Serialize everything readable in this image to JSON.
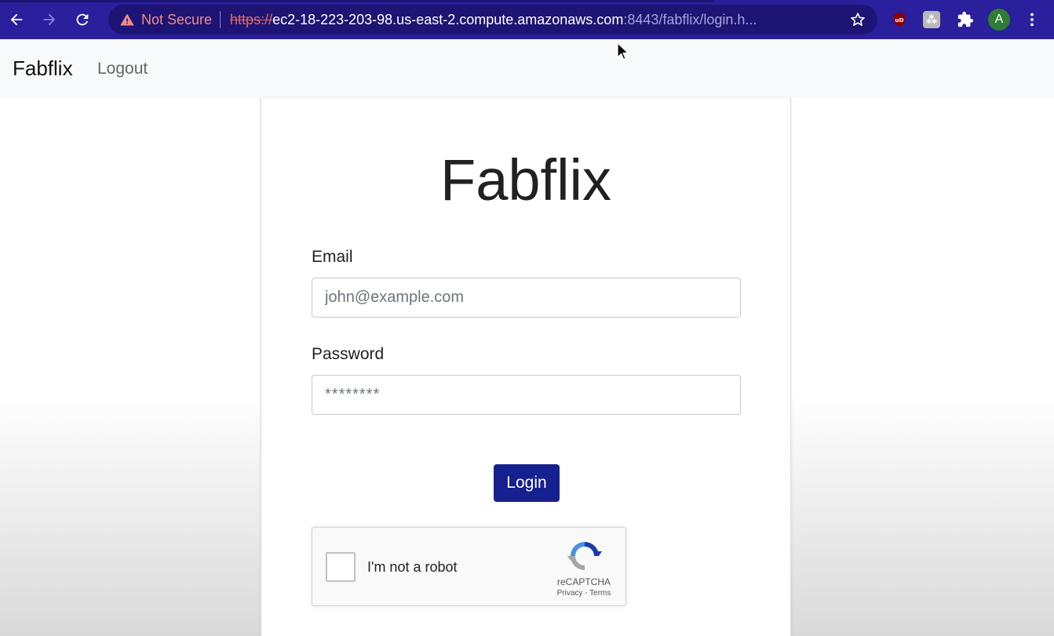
{
  "browser": {
    "security_label": "Not Secure",
    "url_scheme": "https://",
    "url_host": "ec2-18-223-203-98.us-east-2.compute.amazonaws.com",
    "url_rest": ":8443/fabflix/login.h...",
    "profile_initial": "A",
    "icons": [
      "back-arrow-icon",
      "forward-arrow-icon",
      "reload-icon",
      "warning-icon",
      "star-icon",
      "ublock-icon",
      "extension-icon",
      "puzzle-icon",
      "more-vert-icon"
    ],
    "colors": {
      "toolbar": "#2a1f9c",
      "omnibox": "#1d1473",
      "not_secure": "#f08a8a"
    }
  },
  "navbar": {
    "brand": "Fabflix",
    "logout": "Logout"
  },
  "login": {
    "title": "Fabflix",
    "email_label": "Email",
    "email_placeholder": "john@example.com",
    "password_label": "Password",
    "password_placeholder": "********",
    "login_button": "Login",
    "colors": {
      "button": "#17208f"
    }
  },
  "recaptcha": {
    "label": "I'm not a robot",
    "brand": "reCAPTCHA",
    "privacy": "Privacy",
    "separator": " - ",
    "terms": "Terms",
    "checked": false
  }
}
